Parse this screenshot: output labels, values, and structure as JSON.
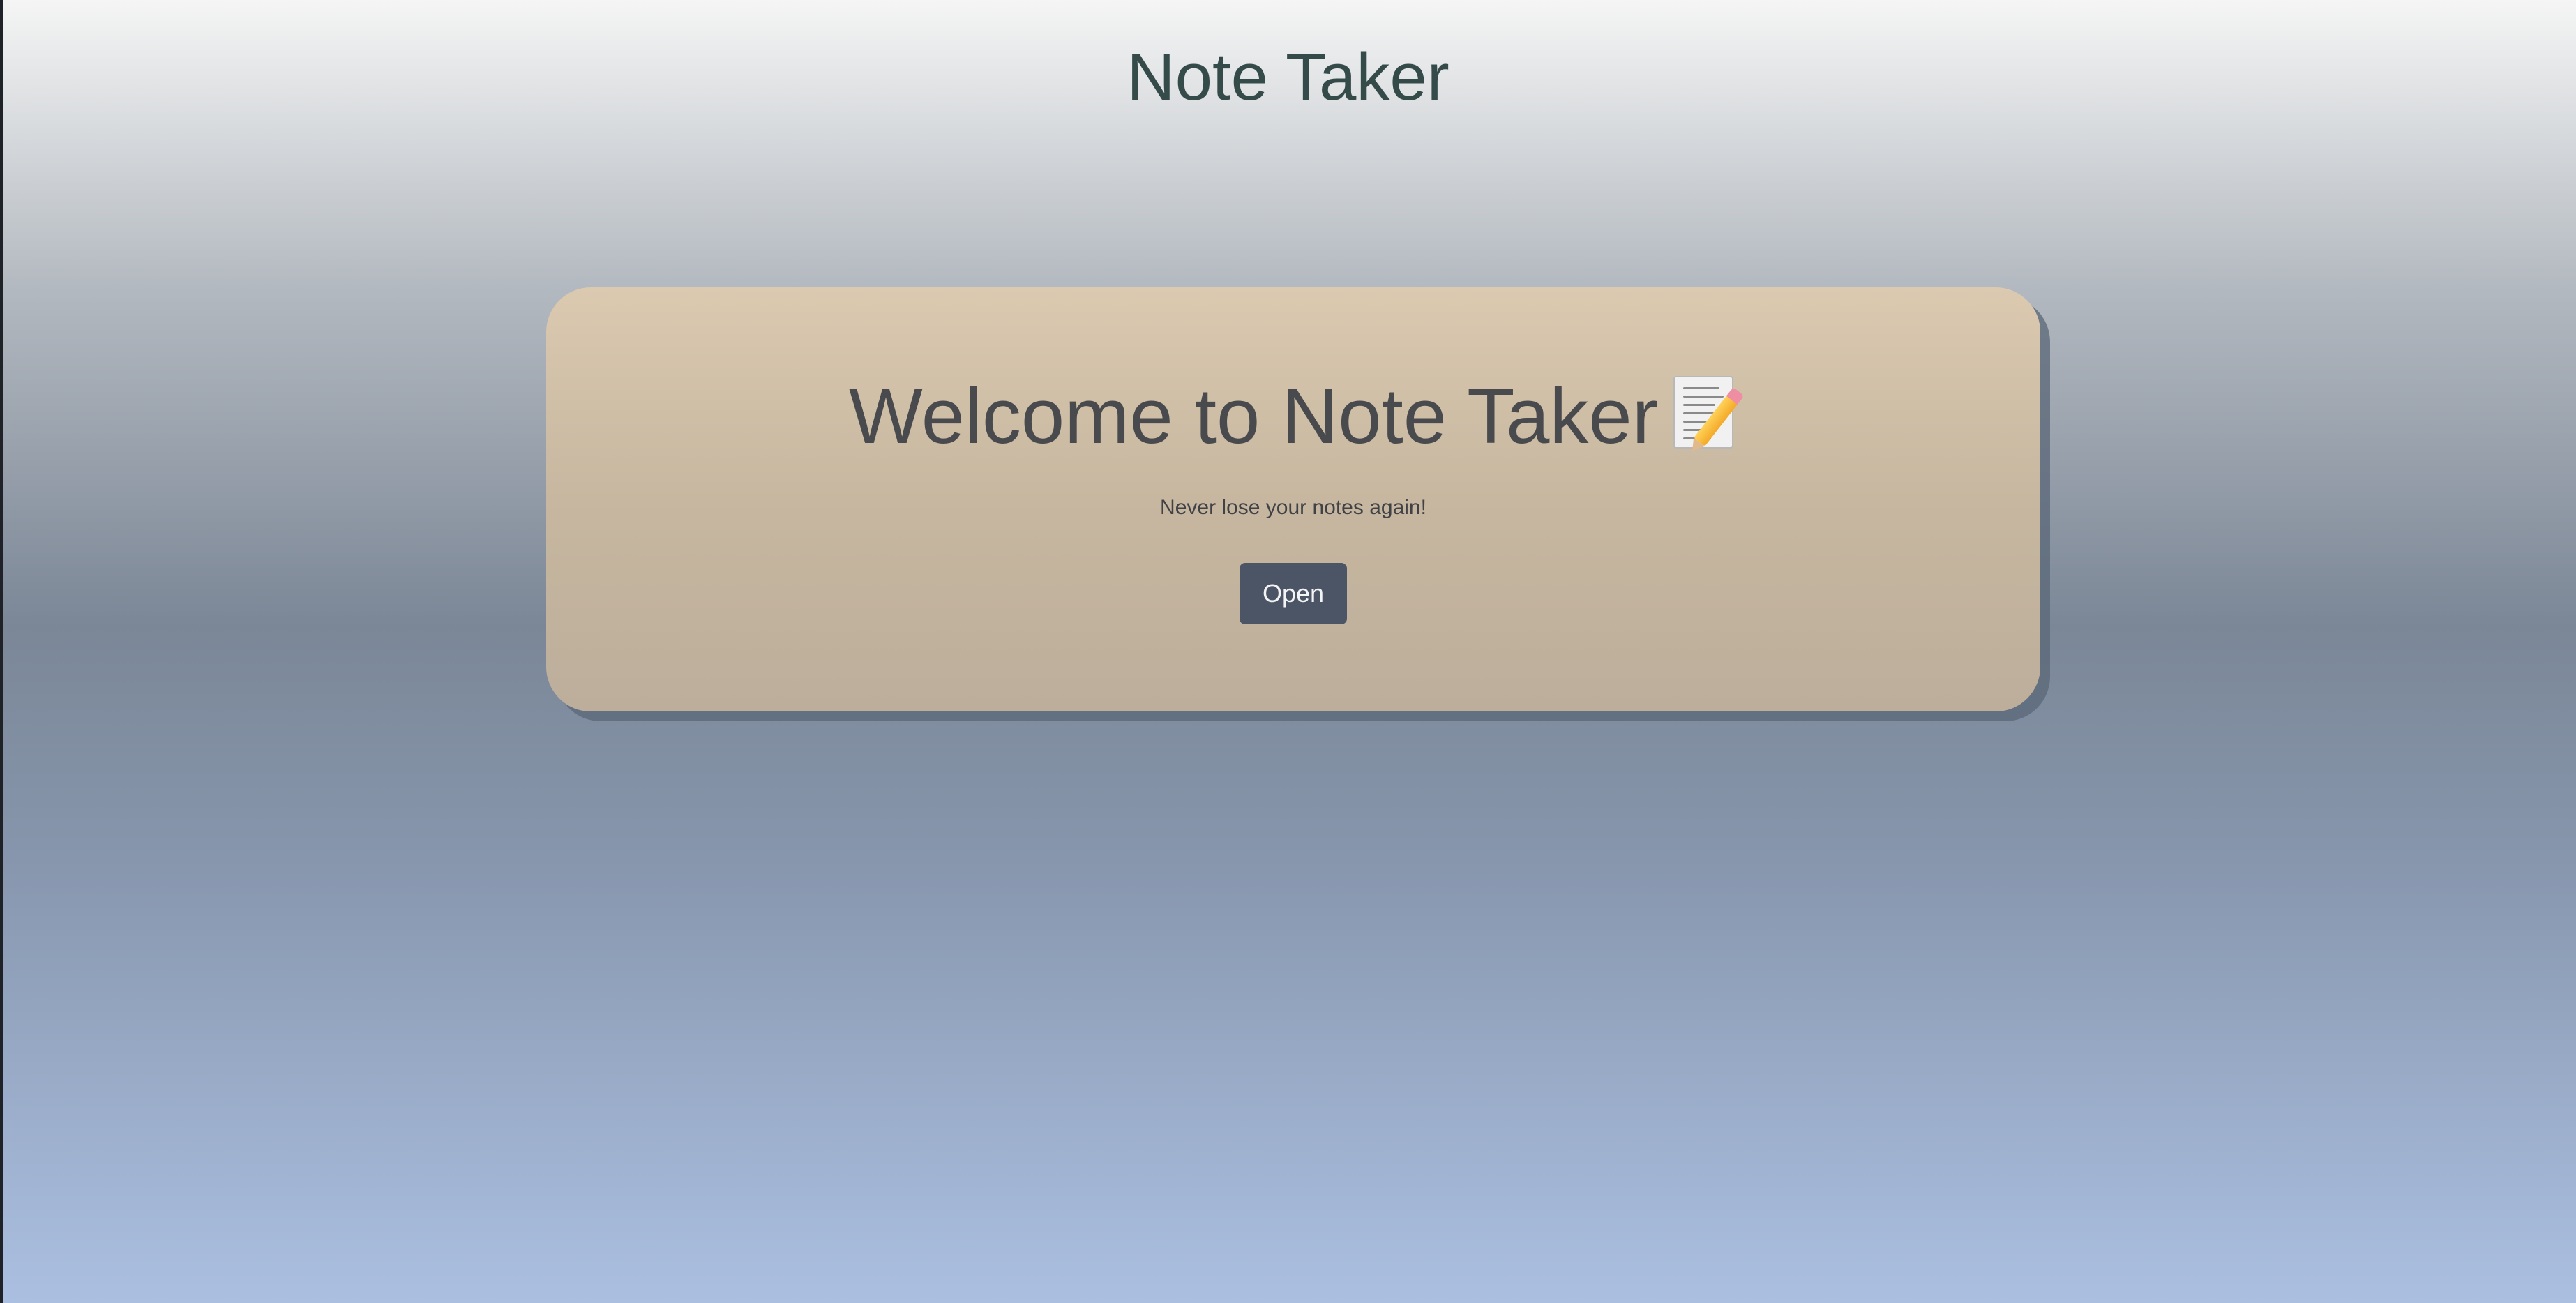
{
  "header": {
    "title": "Note Taker"
  },
  "welcome_card": {
    "heading": "Welcome to Note Taker",
    "heading_icon": "memo-pencil-icon",
    "subtitle": "Never lose your notes again!",
    "button_label": "Open"
  },
  "colors": {
    "title_text": "#344b4a",
    "card_top": "#dbc9b0",
    "card_bottom": "#bcae9b",
    "button_background": "#4b5565",
    "button_text": "#f4f4f4",
    "background_top": "#f5f5f5",
    "background_bottom": "#abbfe1"
  }
}
